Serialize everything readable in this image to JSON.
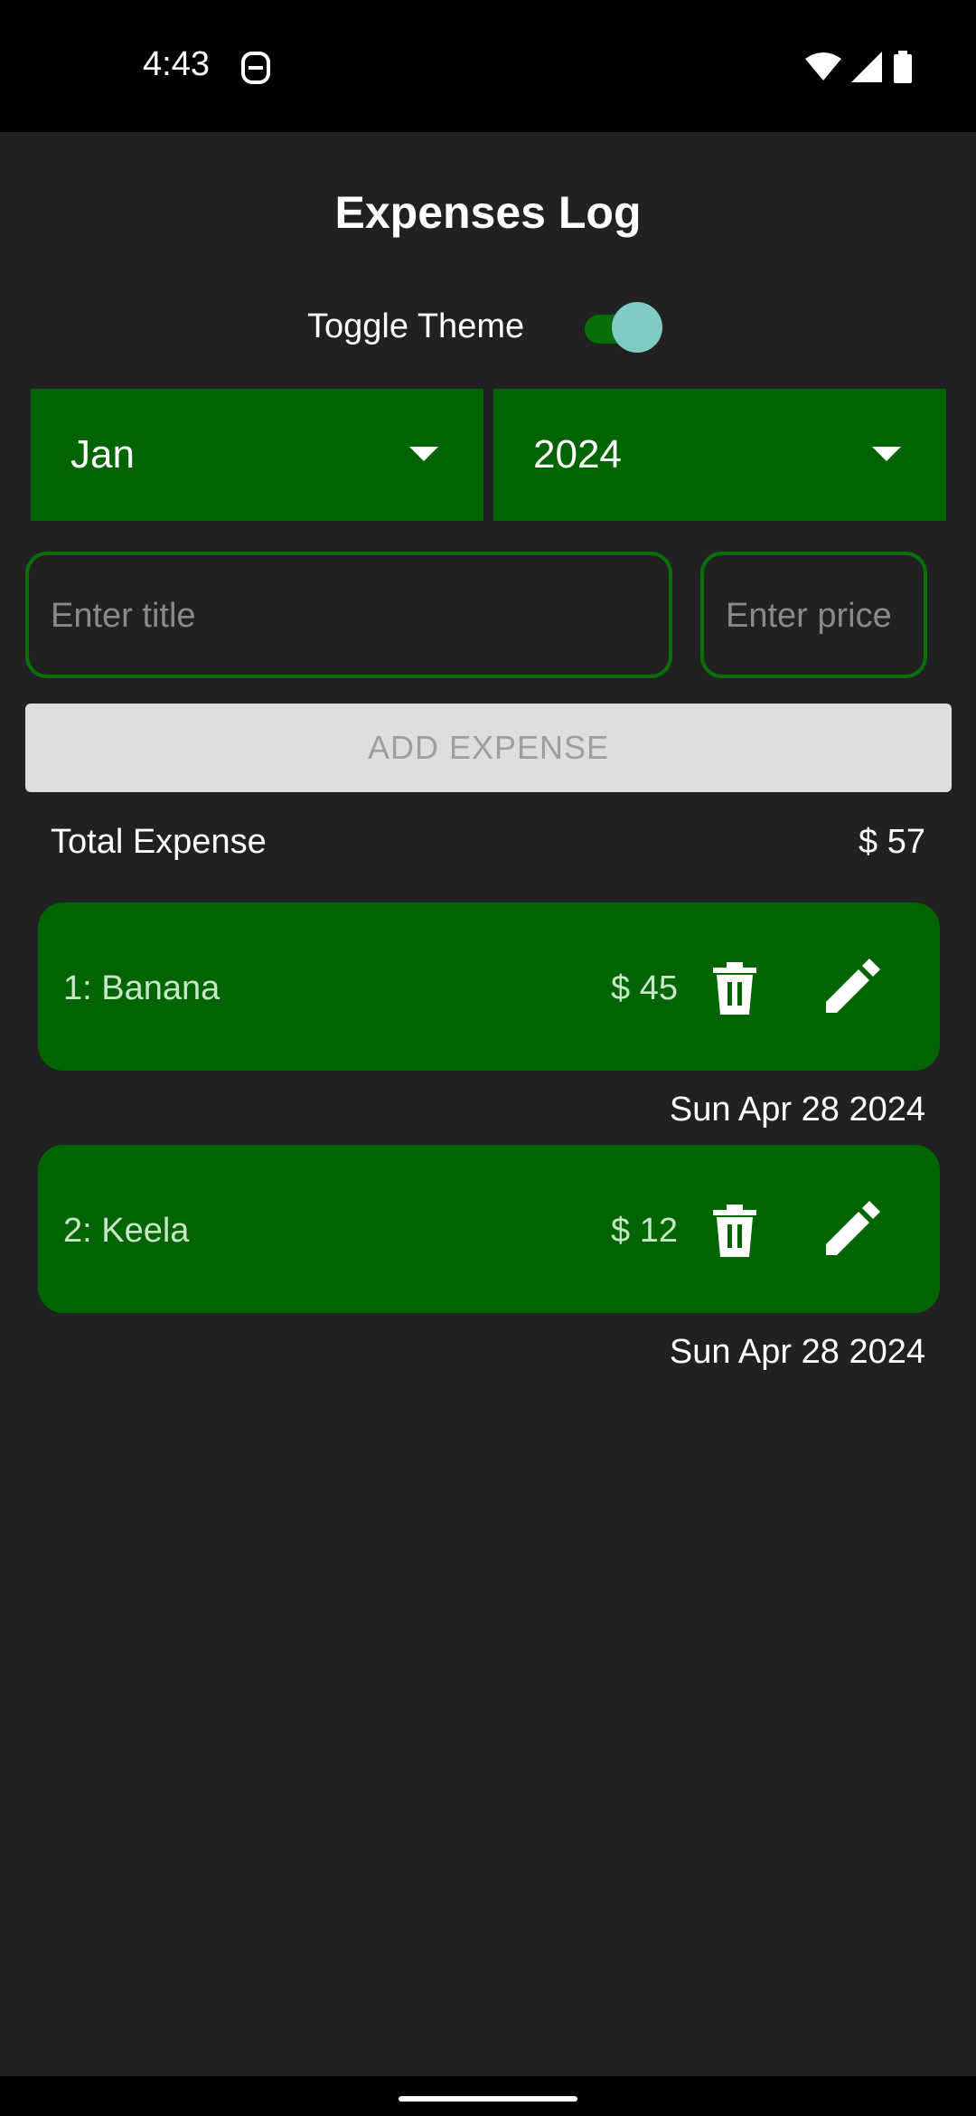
{
  "status_bar": {
    "time": "4:43",
    "icons": [
      "sim-card-icon",
      "wifi-icon",
      "signal-icon",
      "battery-icon"
    ]
  },
  "app": {
    "title": "Expenses Log",
    "toggle_label": "Toggle Theme",
    "toggle_on": true
  },
  "filters": {
    "month": "Jan",
    "year": "2024"
  },
  "form": {
    "title_placeholder": "Enter title",
    "price_placeholder": "Enter price",
    "add_button": "ADD EXPENSE"
  },
  "summary": {
    "total_label": "Total Expense",
    "total_value": "$ 57"
  },
  "expenses": [
    {
      "name": "1: Banana",
      "price": "$ 45",
      "date": "Sun Apr 28 2024"
    },
    {
      "name": "2: Keela",
      "price": "$ 12",
      "date": "Sun Apr 28 2024"
    }
  ],
  "colors": {
    "background": "#212121",
    "card": "#006400",
    "accent": "#80cbc4",
    "field_border": "#0a6f0a"
  }
}
